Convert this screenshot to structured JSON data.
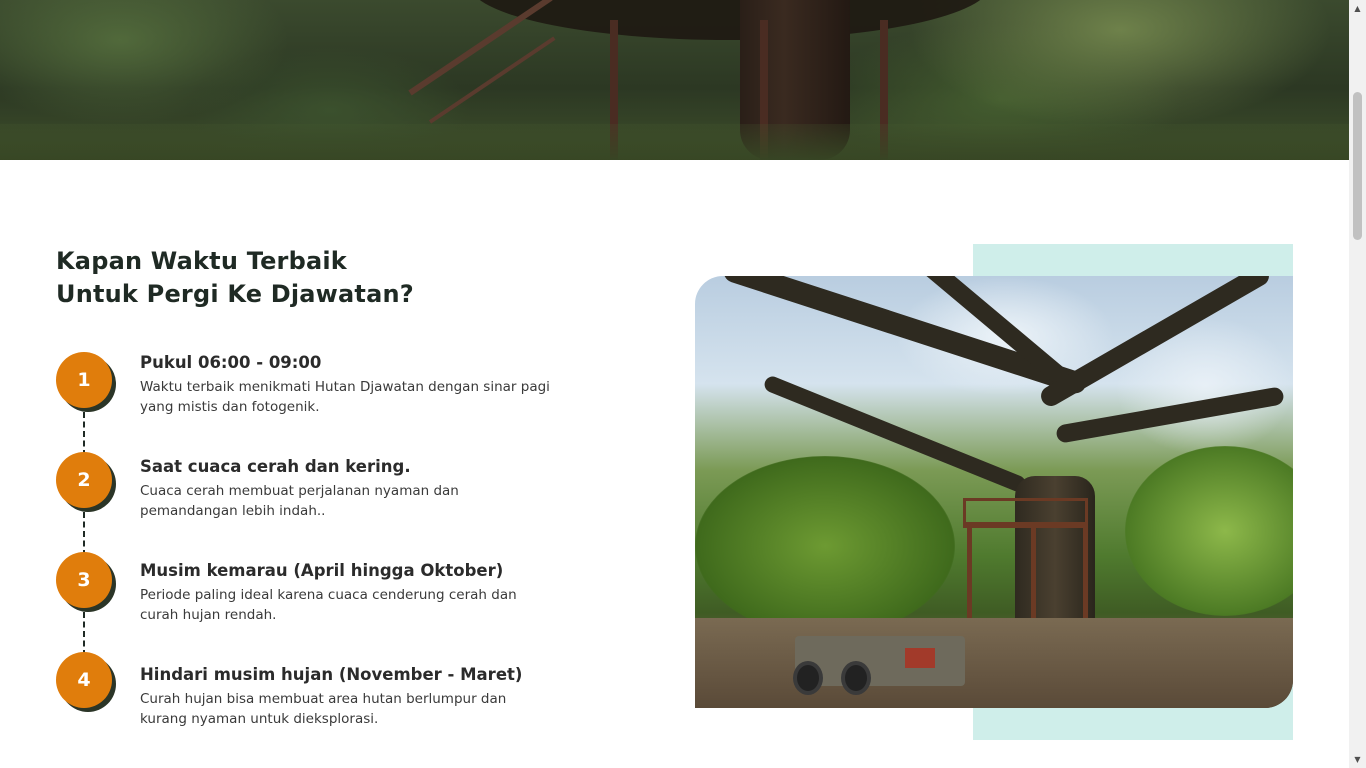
{
  "hero": {
    "image_description_icon": "forest-treehouse-image"
  },
  "section": {
    "heading_line1": "Kapan Waktu Terbaik",
    "heading_line2": "Untuk Pergi Ke Djawatan?"
  },
  "steps": [
    {
      "number": "1",
      "title": "Pukul 06:00 - 09:00",
      "description": "Waktu terbaik menikmati Hutan Djawatan dengan sinar pagi yang mistis dan fotogenik."
    },
    {
      "number": "2",
      "title": "Saat cuaca cerah dan kering.",
      "description": "Cuaca cerah membuat perjalanan nyaman dan pemandangan lebih indah.."
    },
    {
      "number": "3",
      "title": "Musim kemarau (April hingga Oktober)",
      "description": "Periode paling ideal karena cuaca cenderung cerah dan curah hujan rendah."
    },
    {
      "number": "4",
      "title": "Hindari musim hujan (November - Maret)",
      "description": "Curah hujan bisa membuat area hutan berlumpur dan kurang nyaman untuk dieksplorasi."
    }
  ],
  "colors": {
    "accent_orange": "#e07d0c",
    "badge_shadow": "#2b3527",
    "teal_panel": "#cfeeea",
    "heading_text": "#1f2a24"
  },
  "scrollbar": {
    "up_icon": "scroll-up-arrow-icon",
    "down_icon": "scroll-down-arrow-icon"
  }
}
